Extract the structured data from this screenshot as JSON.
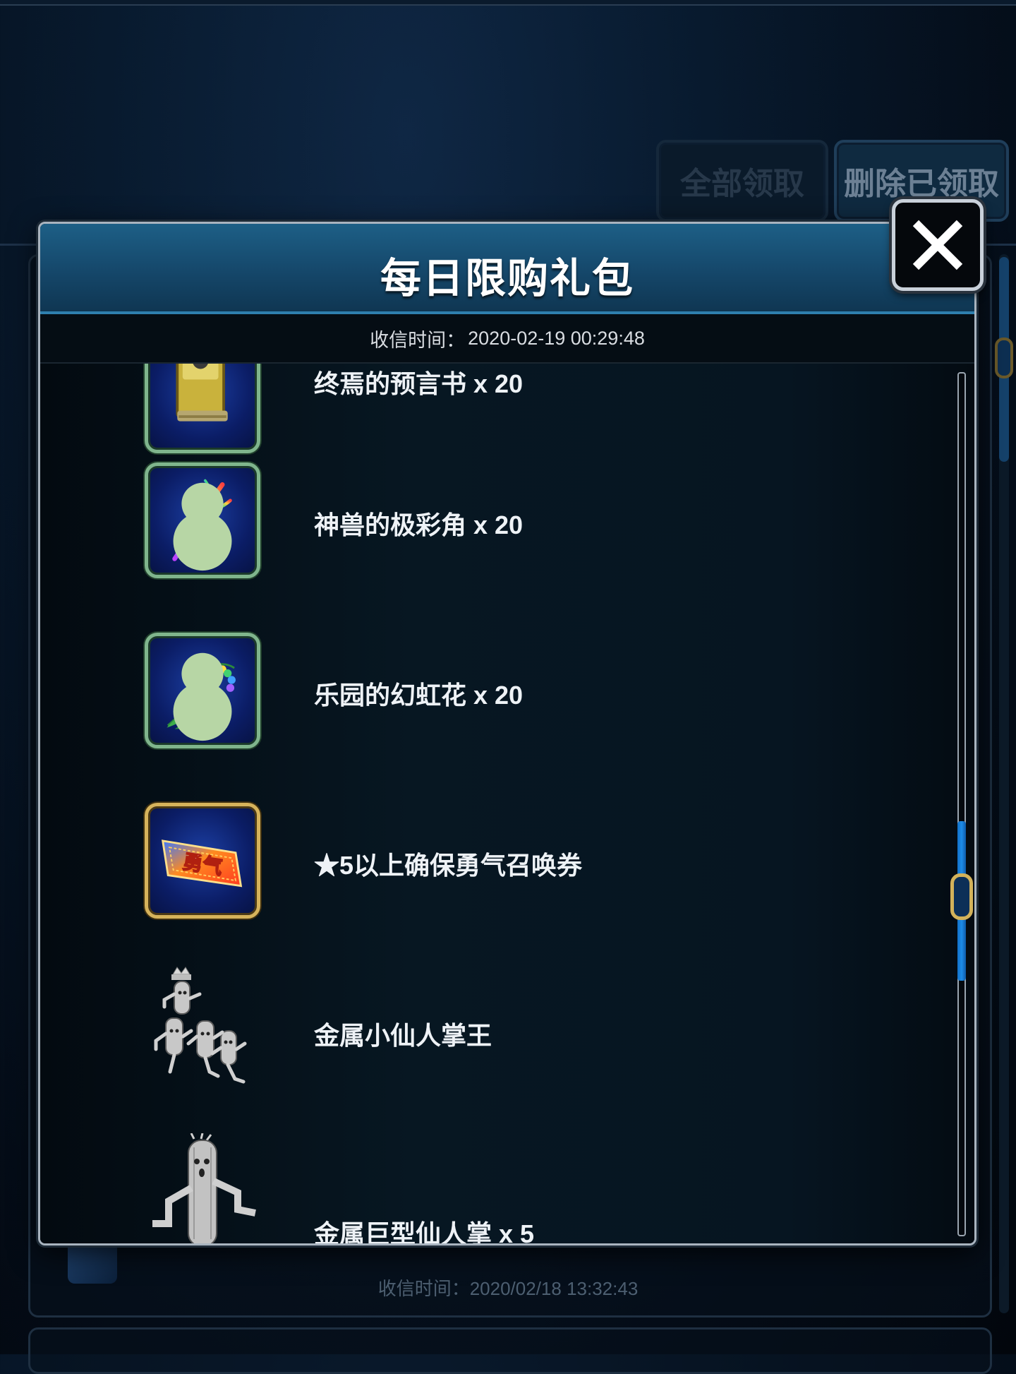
{
  "background": {
    "buttons": {
      "claim_all": "全部领取",
      "delete_claimed": "删除已领取"
    },
    "next_card_receive_time": "收信时间：2020/02/18 13:32:43"
  },
  "modal": {
    "title": "每日限购礼包",
    "receive_time_label": "收信时间：",
    "receive_time_value": "2020-02-19 00:29:48",
    "close_icon": "close-x-icon",
    "items": [
      {
        "label": "终焉的预言书 x 20",
        "icon": "prophecy-book-icon",
        "frame": "green"
      },
      {
        "label": "神兽的极彩角 x 20",
        "icon": "rainbow-horn-icon",
        "frame": "green"
      },
      {
        "label": "乐园的幻虹花 x 20",
        "icon": "rainbow-flower-icon",
        "frame": "green"
      },
      {
        "label": "★5以上确保勇气召唤券",
        "icon": "courage-ticket-icon",
        "frame": "gold",
        "ticket_text": "勇气"
      },
      {
        "label": "金属小仙人掌王",
        "icon": "metal-cactuar-king-icon",
        "frame": "none"
      },
      {
        "label": "金属巨型仙人掌 x 5",
        "icon": "metal-giant-cactuar-icon",
        "frame": "none"
      }
    ]
  },
  "colors": {
    "header_blue": "#15476a",
    "frame_green": "#7fb58c",
    "frame_gold": "#d6b35b",
    "scroll_blue": "#1d8ce8"
  }
}
